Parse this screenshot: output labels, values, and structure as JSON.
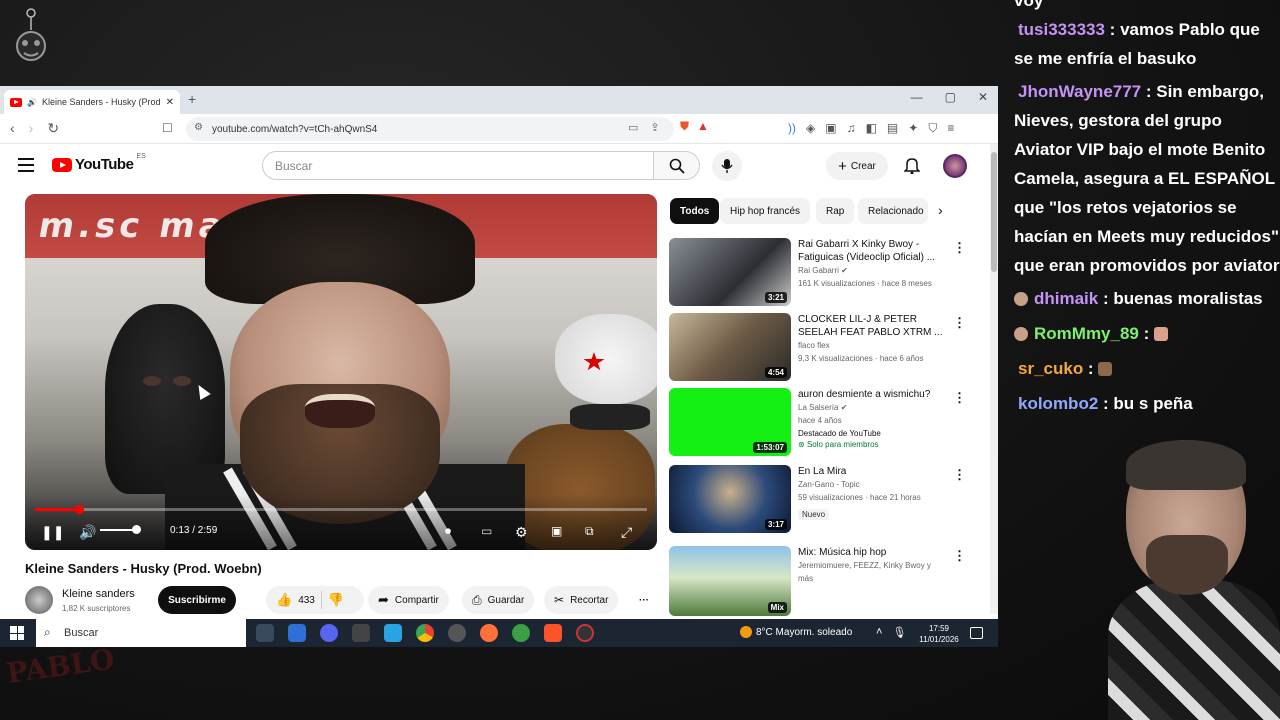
{
  "browser": {
    "tab_title": "Kleine Sanders - Husky (Prod",
    "url": "youtube.com/watch?v=tCh-ahQwnS4",
    "window_controls": [
      "—",
      "▢",
      "✕"
    ]
  },
  "youtube": {
    "logo_text": "YouTube",
    "region": "ES",
    "search_placeholder": "Buscar",
    "create_label": "Crear"
  },
  "video": {
    "title": "Kleine Sanders - Husky (Prod. Woebn)",
    "current_time": "0:13 / 2:59",
    "progress": 0.072,
    "volume": 1.0,
    "overlay_text": "m.sc   man"
  },
  "channel": {
    "name": "Kleine sanders",
    "subscribers": "1,82 K suscriptores",
    "subscribe_label": "Suscribirme"
  },
  "actions": {
    "likes": "433",
    "share": "Compartir",
    "save": "Guardar",
    "clip": "Recortar"
  },
  "chips": [
    "Todos",
    "Hip hop francés",
    "Rap",
    "Relacionado"
  ],
  "recommended": [
    {
      "title": "Rai Gabarri X Kinky Bwoy - Fatiguicas (Videoclip Oficial) ...",
      "channel": "Rai Gabarri",
      "meta": "161 K visualizaciones · hace 8 meses",
      "duration": "3:21",
      "verified": true
    },
    {
      "title": "CLOCKER LIL-J & PETER SEELAH FEAT PABLO XTRM ...",
      "channel": "flaco flex",
      "meta": "9,3 K visualizaciones · hace 6 años",
      "duration": "4:54"
    },
    {
      "title": "auron desmiente a wismichu?",
      "channel": "La Salsería",
      "meta": "hace 4 años",
      "extra": "Destacado de YouTube",
      "member": "Solo para miembros",
      "duration": "1:53:07",
      "verified": true
    },
    {
      "title": "En La Mira",
      "channel": "Zan-Gano - Topic",
      "meta": "59 visualizaciones · hace 21 horas",
      "badge": "Nuevo",
      "duration": "3:17"
    },
    {
      "title": "Mix: Música hip hop",
      "channel": "Jeremiomuere, FEEZZ, Kinky Bwoy y más",
      "meta": "",
      "duration": "Mix"
    }
  ],
  "taskbar": {
    "search": "Buscar",
    "weather": "8°C  Mayorm. soleado",
    "time": "17:59",
    "date": "11/01/2026"
  },
  "chat": [
    {
      "user": "",
      "text": "voy"
    },
    {
      "user": "tusi333333",
      "text": "vamos Pablo que se me enfría el basuko"
    },
    {
      "user": "JhonWayne777",
      "text": "Sin embargo, Nieves, gestora del grupo Aviator VIP bajo el mote Benito Camela, asegura a EL ESPAÑOL que \"los retos vejatorios se hacían en Meets muy reducidos\" que eran promovidos por aviator"
    },
    {
      "user": "dhimaik",
      "text": "buenas moralistas"
    },
    {
      "user": "RomMmy_89",
      "text": ""
    },
    {
      "user": "sr_cuko",
      "text": ""
    },
    {
      "user": "kolombo2",
      "text": "bu        s peña"
    }
  ],
  "colors": {
    "yt_red": "#ff0000",
    "chip_active": "#0f0f0f",
    "taskbar": "#1c2532"
  }
}
